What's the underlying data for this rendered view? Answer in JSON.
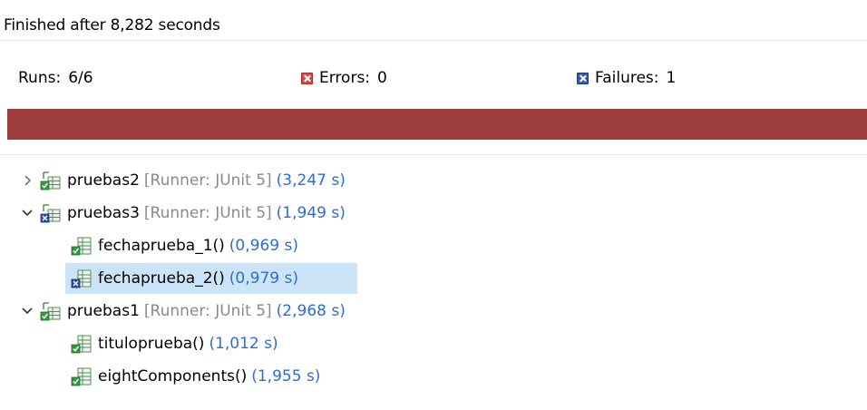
{
  "status": {
    "text": "Finished after 8,282 seconds"
  },
  "counters": {
    "runs_label": "Runs:",
    "runs_value": "6/6",
    "errors_label": "Errors:",
    "errors_value": "0",
    "failures_label": "Failures:",
    "failures_value": "1"
  },
  "progress": {
    "fraction": 1.0,
    "color": "#9c3c3c"
  },
  "tree": {
    "suites": [
      {
        "name": "pruebas2",
        "runner": "[Runner: JUnit 5]",
        "time": "(3,247 s)",
        "expanded": false,
        "status": "passed",
        "tests": []
      },
      {
        "name": "pruebas3",
        "runner": "[Runner: JUnit 5]",
        "time": "(1,949 s)",
        "expanded": true,
        "status": "failed",
        "tests": [
          {
            "name": "fechaprueba_1()",
            "time": "(0,969 s)",
            "status": "passed",
            "selected": false
          },
          {
            "name": "fechaprueba_2()",
            "time": "(0,979 s)",
            "status": "failed",
            "selected": true
          }
        ]
      },
      {
        "name": "pruebas1",
        "runner": "[Runner: JUnit 5]",
        "time": "(2,968 s)",
        "expanded": true,
        "status": "passed",
        "tests": [
          {
            "name": "tituloprueba()",
            "time": "(1,012 s)",
            "status": "passed",
            "selected": false
          },
          {
            "name": "eightComponents()",
            "time": "(1,955 s)",
            "status": "passed",
            "selected": false
          }
        ]
      }
    ]
  },
  "colors": {
    "failure_bar": "#9c3c3c",
    "selection": "#cce4f7",
    "runner_text": "#8a8a8a",
    "time_text": "#2f6ec8"
  }
}
